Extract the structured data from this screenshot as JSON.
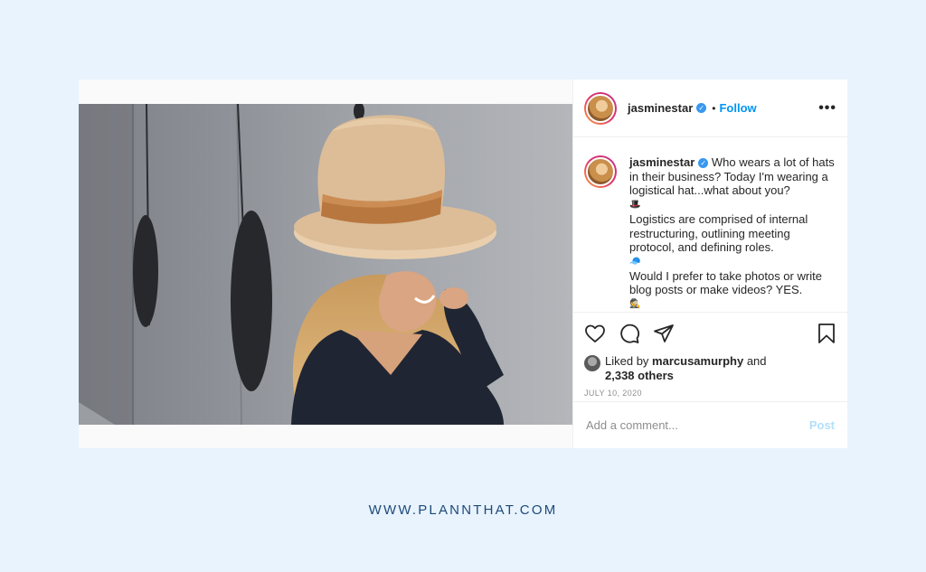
{
  "post": {
    "username": "jasminestar",
    "follow_label": "Follow",
    "dot": "•",
    "more_label": "•••",
    "caption": {
      "line1": "Who wears a lot of hats in their business? Today I'm wearing a logistical hat...what about you?",
      "line2": "Logistics are comprised of internal restructuring, outlining meeting protocol, and defining roles.",
      "line3": "Would I prefer to take photos or write blog posts or make videos? YES.",
      "emoji1": "🎩",
      "emoji2": "🧢",
      "emoji3": "🕵"
    },
    "likes": {
      "prefix": "Liked by",
      "user": "marcusamurphy",
      "conj": "and",
      "others": "2,338 others"
    },
    "date": "JULY 10, 2020",
    "comment_placeholder": "Add a comment...",
    "post_label": "Post"
  },
  "footer": {
    "url": "WWW.PLANNTHAT.COM"
  },
  "colors": {
    "accent": "#0095f6",
    "background": "#e8f3fd",
    "footer_text": "#1e4a7a"
  }
}
